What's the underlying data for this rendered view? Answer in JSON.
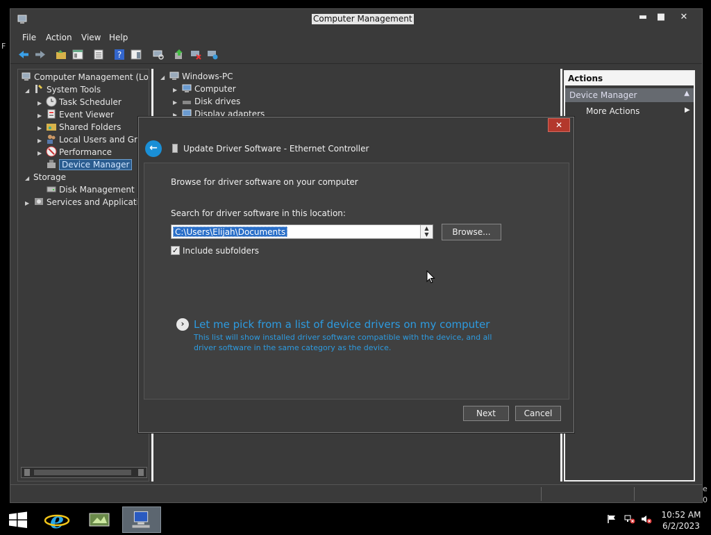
{
  "window": {
    "title": "Computer Management",
    "controls": {
      "minimize": "▬",
      "maximize": "■",
      "close": "✕"
    }
  },
  "menu": [
    "File",
    "Action",
    "View",
    "Help"
  ],
  "toolbar_icons": [
    "back-arrow-icon",
    "forward-arrow-icon",
    "up-folder-icon",
    "show-hide-tree-icon",
    "properties-icon",
    "help-icon",
    "show-action-pane-icon",
    "scan-hardware-icon",
    "update-driver-icon",
    "disable-device-icon",
    "uninstall-device-icon"
  ],
  "left_tree": {
    "root": "Computer Management (Local",
    "items": [
      {
        "label": "System Tools",
        "level": 1
      },
      {
        "label": "Task Scheduler",
        "level": 2
      },
      {
        "label": "Event Viewer",
        "level": 2
      },
      {
        "label": "Shared Folders",
        "level": 2
      },
      {
        "label": "Local Users and Grou",
        "level": 2
      },
      {
        "label": "Performance",
        "level": 2
      },
      {
        "label": "Device Manager",
        "level": 2,
        "selected": true
      },
      {
        "label": "Storage",
        "level": 1
      },
      {
        "label": "Disk Management",
        "level": 2
      },
      {
        "label": "Services and Application",
        "level": 1
      }
    ]
  },
  "device_tree": {
    "root": "Windows-PC",
    "items": [
      "Computer",
      "Disk drives",
      "Display adapters"
    ]
  },
  "actions": {
    "header": "Actions",
    "section": "Device Manager",
    "more": "More Actions"
  },
  "dialog": {
    "title": "Update Driver Software - Ethernet Controller",
    "close": "✕",
    "back": "←",
    "heading": "Browse for driver software on your computer",
    "search_label": "Search for driver software in this location:",
    "path": "C:\\Users\\Elijah\\Documents",
    "browse": "Browse...",
    "include_subfolders": "Include subfolders",
    "include_subfolders_checked": true,
    "pick_link": "Let me pick from a list of device drivers on my computer",
    "pick_desc": "This list will show installed driver software compatible with the device, and all driver software in the same category as the device.",
    "next": "Next",
    "cancel": "Cancel"
  },
  "taskbar": {
    "clock_time": "10:52 AM",
    "clock_date": "6/2/2023"
  },
  "edge_text": {
    "left_char": "F",
    "right_char1": "e",
    "right_char2": "0"
  },
  "colors": {
    "accent": "#2d9be0",
    "selection": "#2a5c8f",
    "close_red": "#b3382c"
  }
}
